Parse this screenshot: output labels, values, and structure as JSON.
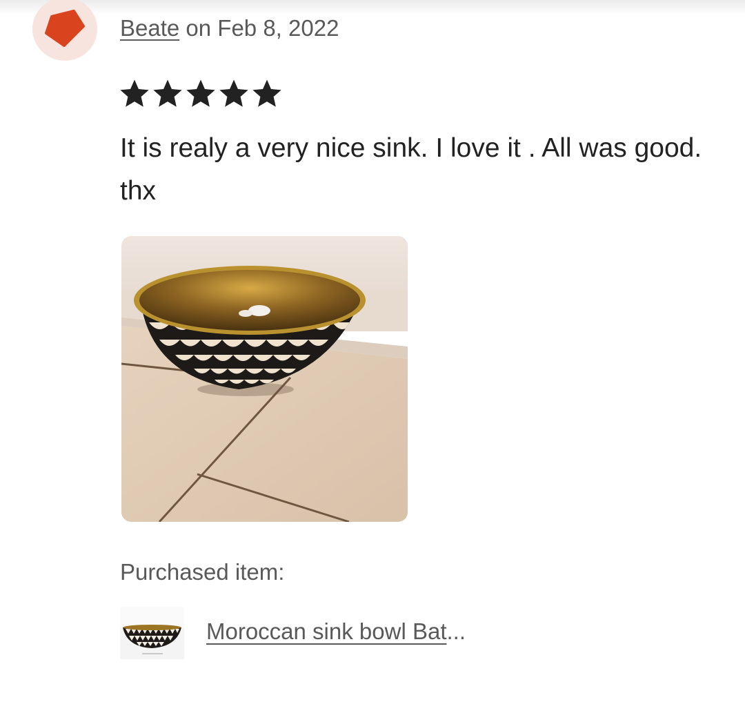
{
  "reviewer": {
    "name": "Beate",
    "date_text": " on Feb 8, 2022",
    "avatar_icon": "orange-pentagon-avatar-icon",
    "avatar_color": "#d9441e",
    "avatar_bg": "#f7e4df"
  },
  "rating": {
    "value": 5,
    "max": 5,
    "star_color": "#222222"
  },
  "review": {
    "text": "It is realy a very nice sink. I love it . All was good. thx"
  },
  "photo": {
    "description_icon": "review-photo-sink-bowl"
  },
  "purchased": {
    "label": "Purchased item:",
    "item_title": "Moroccan sink bowl Bat",
    "ellipsis": "..."
  }
}
